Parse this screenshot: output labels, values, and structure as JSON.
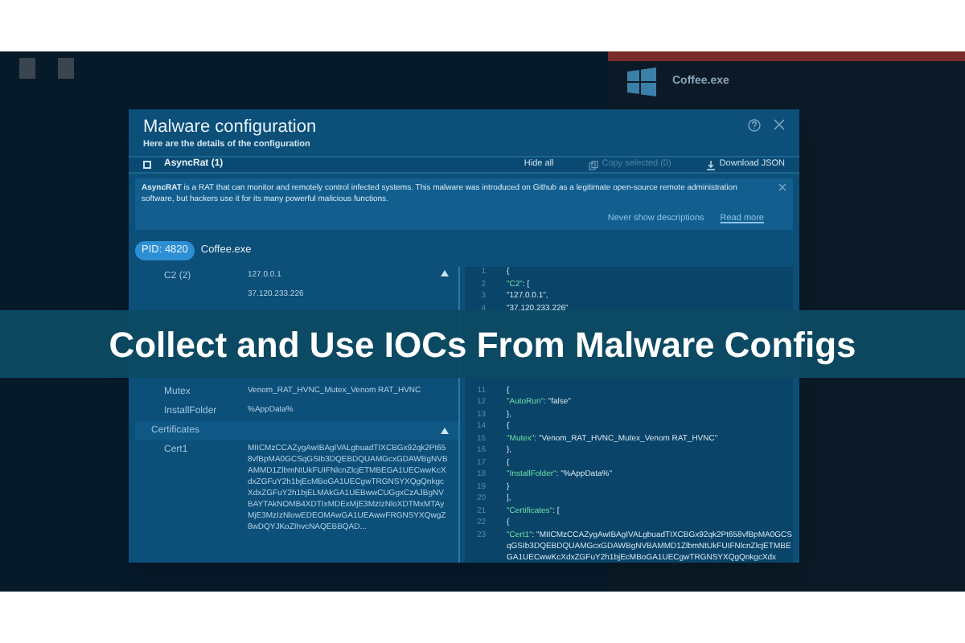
{
  "background": {
    "process_title": "Coffee.exe"
  },
  "dialog": {
    "title": "Malware configuration",
    "subtitle": "Here are the details of the configuration",
    "family": {
      "label": "AsyncRat (1)",
      "checked": false
    },
    "actions": [
      {
        "label": "Hide all",
        "kind": "text",
        "disabled": false
      },
      {
        "label": "Copy selected (0)",
        "kind": "copy",
        "disabled": true
      },
      {
        "label": "Download JSON",
        "kind": "download",
        "disabled": false
      }
    ],
    "description": {
      "text": "**AsyncRAT** is a RAT that can monitor and remotely control infected systems. This malware was introduced on Github as a legitimate open-source remote administration software, but hackers use it for its many powerful malicious functions.",
      "links": [
        "Never show descriptions",
        "Read more"
      ]
    },
    "pid": "PID: 4820",
    "process": "Coffee.exe",
    "fields_top": [
      {
        "kind": "field",
        "key": "C2 (2)",
        "value": "127.0.0.1",
        "expanded": true
      },
      {
        "kind": "value",
        "value": "37.120.233.226"
      }
    ],
    "fields_bottom": [
      {
        "kind": "field",
        "key": "Mutex",
        "value": "Venom_RAT_HVNC_Mutex_Venom RAT_HVNC"
      },
      {
        "kind": "field",
        "key": "InstallFolder",
        "value": "%AppData%"
      },
      {
        "kind": "group",
        "key": "Certificates",
        "expanded": true
      },
      {
        "kind": "field",
        "key": "Cert1",
        "value": "MIICMzCCAZygAwIBAgIVALgbuadTIXCBGx92qk2Pt658vfBpMA0GCSqGSIb3DQEBDQUAMGcxGDAWBgNVBAMMD1ZlbmNtUkFUIFNlcnZlcjETMBEGA1UECwwKcXdxZGFuY2h1bjEcMBoGA1UECgwTRGNSYXQgQnkgcXdxZGFuY2h1bjELMAkGA1UEBwwCUGgxCzAJBgNVBAYTAkNOMB4XDTIxMDExMjE3MzIzNloXDTMxMTAyMjE3MzIzNlowEDEOMAwGA1UEAwwFRGNSYXQwgZ8wDQYJKoZIhvcNAQEBBQAD..."
      }
    ],
    "code_top": [
      {
        "number": "1",
        "text": "{"
      },
      {
        "number": "2",
        "key": "\"C2\"",
        "text": ": ["
      },
      {
        "number": "3",
        "text": "\"127.0.0.1\","
      },
      {
        "number": "4",
        "text": "\"37.120.233.226\""
      }
    ],
    "code_bottom": [
      {
        "number": "11",
        "text": "{"
      },
      {
        "number": "12",
        "key": "\"AutoRun\"",
        "text": ": \"false\""
      },
      {
        "number": "13",
        "text": "},"
      },
      {
        "number": "14",
        "text": "{"
      },
      {
        "number": "15",
        "key": "\"Mutex\"",
        "text": ": \"Venom_RAT_HVNC_Mutex_Venom RAT_HVNC\""
      },
      {
        "number": "16",
        "text": "},"
      },
      {
        "number": "17",
        "text": "{"
      },
      {
        "number": "18",
        "key": "\"InstallFolder\"",
        "text": ": \"%AppData%\""
      },
      {
        "number": "19",
        "text": "}"
      },
      {
        "number": "20",
        "text": "],"
      },
      {
        "number": "21",
        "key": "\"Certificates\"",
        "text": ": ["
      },
      {
        "number": "22",
        "text": "{"
      },
      {
        "number": "23",
        "key": "\"Cert1\"",
        "text": ": \"MIICMzCCAZygAwIBAgIVALgbuadTIXCBGx92qk2Pt658vfBpMA0GCSqGSIb3DQEBDQUAMGcxGDAWBgNVBAMMD1ZlbmNtUkFUIFNlcnZlcjETMBEGA1UECwwKcXdxZGFuY2h1bjEcMBoGA1UECgwTRGNSYXQgQnkgcXdx"
      }
    ]
  },
  "banner": {
    "title": "Collect and Use IOCs From Malware Configs"
  }
}
